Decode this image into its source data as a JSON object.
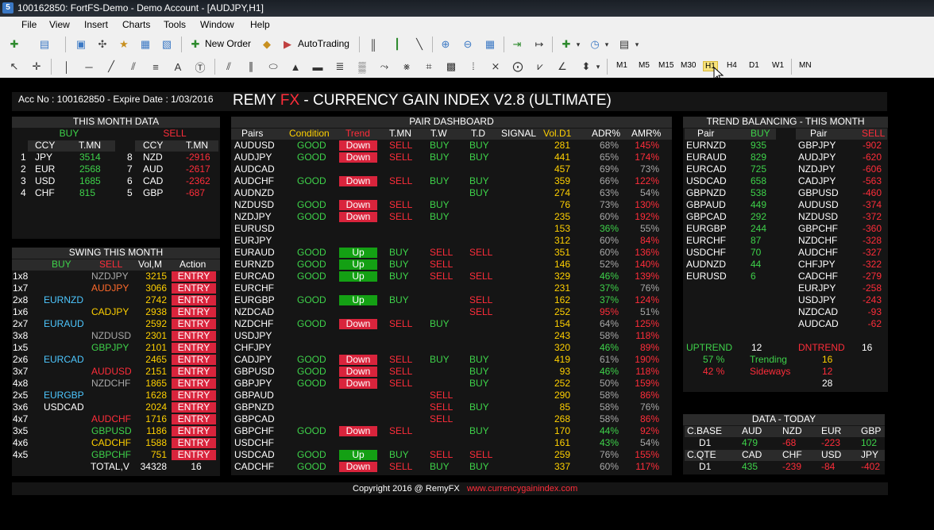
{
  "window": {
    "title": "100162850: FortFS-Demo - Demo Account - [AUDJPY,H1]"
  },
  "menu": [
    "File",
    "View",
    "Insert",
    "Charts",
    "Tools",
    "Window",
    "Help"
  ],
  "toolbar": {
    "new_order": "New Order",
    "autotrading": "AutoTrading"
  },
  "timeframes": [
    "M1",
    "M5",
    "M15",
    "M30",
    "H1",
    "H4",
    "D1",
    "W1",
    "MN"
  ],
  "header": {
    "acc": "Acc No : 100162850 - Expire Date : 1/03/2016",
    "brand1": "REMY ",
    "brand2": "FX",
    "brand3": " - CURRENCY GAIN INDEX V2.8 (ULTIMATE)"
  },
  "month": {
    "title": "THIS MONTH DATA",
    "buy": "BUY",
    "sell": "SELL",
    "col_ccy": "CCY",
    "col_tmn": "T.MN",
    "buy_rows": [
      {
        "n": "1",
        "ccy": "JPY",
        "v": "3514"
      },
      {
        "n": "2",
        "ccy": "EUR",
        "v": "2568"
      },
      {
        "n": "3",
        "ccy": "USD",
        "v": "1685"
      },
      {
        "n": "4",
        "ccy": "CHF",
        "v": "815"
      }
    ],
    "sell_rows": [
      {
        "n": "8",
        "ccy": "NZD",
        "v": "-2916"
      },
      {
        "n": "7",
        "ccy": "AUD",
        "v": "-2617"
      },
      {
        "n": "6",
        "ccy": "CAD",
        "v": "-2362"
      },
      {
        "n": "5",
        "ccy": "GBP",
        "v": "-687"
      }
    ]
  },
  "swing": {
    "title": "SWING THIS MONTH",
    "h_buy": "BUY",
    "h_sell": "SELL",
    "h_vol": "Vol,M",
    "h_action": "Action",
    "rows": [
      {
        "r": "1x8",
        "b": "",
        "s": "NZDJPY",
        "sc": "gry",
        "v": "3215",
        "a": "ENTRY"
      },
      {
        "r": "1x7",
        "b": "",
        "s": "AUDJPY",
        "sc": "org",
        "v": "3066",
        "a": "ENTRY"
      },
      {
        "r": "2x8",
        "b": "EURNZD",
        "bc": "cyn",
        "s": "",
        "v": "2742",
        "a": "ENTRY"
      },
      {
        "r": "1x6",
        "b": "",
        "s": "CADJPY",
        "sc": "yel",
        "v": "2938",
        "a": "ENTRY"
      },
      {
        "r": "2x7",
        "b": "EURAUD",
        "bc": "cyn",
        "s": "",
        "v": "2592",
        "a": "ENTRY"
      },
      {
        "r": "3x8",
        "b": "",
        "s": "NZDUSD",
        "sc": "gry",
        "v": "2301",
        "a": "ENTRY"
      },
      {
        "r": "1x5",
        "b": "",
        "s": "GBPJPY",
        "sc": "grn",
        "v": "2101",
        "a": "ENTRY"
      },
      {
        "r": "2x6",
        "b": "EURCAD",
        "bc": "cyn",
        "s": "",
        "v": "2465",
        "a": "ENTRY"
      },
      {
        "r": "3x7",
        "b": "",
        "s": "AUDUSD",
        "sc": "red",
        "v": "2151",
        "a": "ENTRY"
      },
      {
        "r": "4x8",
        "b": "",
        "s": "NZDCHF",
        "sc": "gry",
        "v": "1865",
        "a": "ENTRY"
      },
      {
        "r": "2x5",
        "b": "EURGBP",
        "bc": "cyn",
        "s": "",
        "v": "1628",
        "a": "ENTRY"
      },
      {
        "r": "3x6",
        "b": "USDCAD",
        "bc": "wht",
        "s": "",
        "v": "2024",
        "a": "ENTRY"
      },
      {
        "r": "4x7",
        "b": "",
        "s": "AUDCHF",
        "sc": "red",
        "v": "1716",
        "a": "ENTRY"
      },
      {
        "r": "3x5",
        "b": "",
        "s": "GBPUSD",
        "sc": "grn",
        "v": "1186",
        "a": "ENTRY"
      },
      {
        "r": "4x6",
        "b": "",
        "s": "CADCHF",
        "sc": "yel",
        "v": "1588",
        "a": "ENTRY"
      },
      {
        "r": "4x5",
        "b": "",
        "s": "GBPCHF",
        "sc": "grn",
        "v": "751",
        "a": "ENTRY"
      }
    ],
    "total_label": "TOTAL,V",
    "total_vol": "34328",
    "total_count": "16"
  },
  "dashboard": {
    "title": "PAIR DASHBOARD",
    "cols": {
      "pairs": "Pairs",
      "cond": "Condition",
      "trend": "Trend",
      "tmn": "T.MN",
      "tw": "T.W",
      "td": "T.D",
      "signal": "SIGNAL",
      "vol": "Vol.D1",
      "adr": "ADR%",
      "amr": "AMR%"
    },
    "rows": [
      {
        "p": "AUDUSD",
        "c": "GOOD",
        "t": "Down",
        "m": "SELL",
        "w": "BUY",
        "d": "BUY",
        "v": "281",
        "adr": "68%",
        "ac": "gry",
        "amr": "145%",
        "mc": "red"
      },
      {
        "p": "AUDJPY",
        "c": "GOOD",
        "t": "Down",
        "m": "SELL",
        "w": "BUY",
        "d": "BUY",
        "v": "441",
        "adr": "65%",
        "ac": "gry",
        "amr": "174%",
        "mc": "red"
      },
      {
        "p": "AUDCAD",
        "c": "",
        "t": "",
        "m": "",
        "w": "",
        "d": "",
        "v": "457",
        "adr": "69%",
        "ac": "gry",
        "amr": "73%",
        "mc": "gry"
      },
      {
        "p": "AUDCHF",
        "c": "GOOD",
        "t": "Down",
        "m": "SELL",
        "w": "BUY",
        "d": "BUY",
        "v": "359",
        "adr": "66%",
        "ac": "gry",
        "amr": "122%",
        "mc": "red"
      },
      {
        "p": "AUDNZD",
        "c": "",
        "t": "",
        "m": "",
        "w": "",
        "d": "BUY",
        "v": "274",
        "adr": "63%",
        "ac": "gry",
        "amr": "54%",
        "mc": "gry"
      },
      {
        "p": "NZDUSD",
        "c": "GOOD",
        "t": "Down",
        "m": "SELL",
        "w": "BUY",
        "d": "",
        "v": "76",
        "adr": "73%",
        "ac": "gry",
        "amr": "130%",
        "mc": "red"
      },
      {
        "p": "NZDJPY",
        "c": "GOOD",
        "t": "Down",
        "m": "SELL",
        "w": "BUY",
        "d": "",
        "v": "235",
        "adr": "60%",
        "ac": "gry",
        "amr": "192%",
        "mc": "red"
      },
      {
        "p": "EURUSD",
        "c": "",
        "t": "",
        "m": "",
        "w": "",
        "d": "",
        "v": "153",
        "adr": "36%",
        "ac": "grn",
        "amr": "55%",
        "mc": "gry"
      },
      {
        "p": "EURJPY",
        "c": "",
        "t": "",
        "m": "",
        "w": "",
        "d": "",
        "v": "312",
        "adr": "60%",
        "ac": "gry",
        "amr": "84%",
        "mc": "red"
      },
      {
        "p": "EURAUD",
        "c": "GOOD",
        "t": "Up",
        "m": "BUY",
        "w": "SELL",
        "d": "SELL",
        "v": "351",
        "adr": "60%",
        "ac": "gry",
        "amr": "136%",
        "mc": "red"
      },
      {
        "p": "EURNZD",
        "c": "GOOD",
        "t": "Up",
        "m": "BUY",
        "w": "SELL",
        "d": "",
        "v": "146",
        "adr": "52%",
        "ac": "gry",
        "amr": "140%",
        "mc": "red"
      },
      {
        "p": "EURCAD",
        "c": "GOOD",
        "t": "Up",
        "m": "BUY",
        "w": "SELL",
        "d": "SELL",
        "v": "329",
        "adr": "46%",
        "ac": "grn",
        "amr": "139%",
        "mc": "red"
      },
      {
        "p": "EURCHF",
        "c": "",
        "t": "",
        "m": "",
        "w": "",
        "d": "",
        "v": "231",
        "adr": "37%",
        "ac": "grn",
        "amr": "76%",
        "mc": "gry"
      },
      {
        "p": "EURGBP",
        "c": "GOOD",
        "t": "Up",
        "m": "BUY",
        "w": "",
        "d": "SELL",
        "v": "162",
        "adr": "37%",
        "ac": "grn",
        "amr": "124%",
        "mc": "red"
      },
      {
        "p": "NZDCAD",
        "c": "",
        "t": "",
        "m": "",
        "w": "",
        "d": "SELL",
        "v": "252",
        "adr": "95%",
        "ac": "red",
        "amr": "51%",
        "mc": "gry"
      },
      {
        "p": "NZDCHF",
        "c": "GOOD",
        "t": "Down",
        "m": "SELL",
        "w": "BUY",
        "d": "",
        "v": "154",
        "adr": "64%",
        "ac": "gry",
        "amr": "125%",
        "mc": "red"
      },
      {
        "p": "USDJPY",
        "c": "",
        "t": "",
        "m": "",
        "w": "",
        "d": "",
        "v": "243",
        "adr": "58%",
        "ac": "gry",
        "amr": "118%",
        "mc": "red"
      },
      {
        "p": "CHFJPY",
        "c": "",
        "t": "",
        "m": "",
        "w": "",
        "d": "",
        "v": "320",
        "adr": "46%",
        "ac": "grn",
        "amr": "89%",
        "mc": "red"
      },
      {
        "p": "CADJPY",
        "c": "GOOD",
        "t": "Down",
        "m": "SELL",
        "w": "BUY",
        "d": "BUY",
        "v": "419",
        "adr": "61%",
        "ac": "gry",
        "amr": "190%",
        "mc": "red"
      },
      {
        "p": "GBPUSD",
        "c": "GOOD",
        "t": "Down",
        "m": "SELL",
        "w": "",
        "d": "BUY",
        "v": "93",
        "adr": "46%",
        "ac": "grn",
        "amr": "118%",
        "mc": "red"
      },
      {
        "p": "GBPJPY",
        "c": "GOOD",
        "t": "Down",
        "m": "SELL",
        "w": "",
        "d": "BUY",
        "v": "252",
        "adr": "50%",
        "ac": "gry",
        "amr": "159%",
        "mc": "red"
      },
      {
        "p": "GBPAUD",
        "c": "",
        "t": "",
        "m": "",
        "w": "SELL",
        "d": "",
        "v": "290",
        "adr": "58%",
        "ac": "gry",
        "amr": "86%",
        "mc": "red"
      },
      {
        "p": "GBPNZD",
        "c": "",
        "t": "",
        "m": "",
        "w": "SELL",
        "d": "BUY",
        "v": "85",
        "adr": "58%",
        "ac": "gry",
        "amr": "76%",
        "mc": "gry"
      },
      {
        "p": "GBPCAD",
        "c": "",
        "t": "",
        "m": "",
        "w": "SELL",
        "d": "",
        "v": "268",
        "adr": "58%",
        "ac": "gry",
        "amr": "86%",
        "mc": "red"
      },
      {
        "p": "GBPCHF",
        "c": "GOOD",
        "t": "Down",
        "m": "SELL",
        "w": "",
        "d": "BUY",
        "v": "170",
        "adr": "44%",
        "ac": "grn",
        "amr": "92%",
        "mc": "red"
      },
      {
        "p": "USDCHF",
        "c": "",
        "t": "",
        "m": "",
        "w": "",
        "d": "",
        "v": "161",
        "adr": "43%",
        "ac": "grn",
        "amr": "54%",
        "mc": "gry"
      },
      {
        "p": "USDCAD",
        "c": "GOOD",
        "t": "Up",
        "m": "BUY",
        "w": "SELL",
        "d": "SELL",
        "v": "259",
        "adr": "76%",
        "ac": "gry",
        "amr": "155%",
        "mc": "red"
      },
      {
        "p": "CADCHF",
        "c": "GOOD",
        "t": "Down",
        "m": "SELL",
        "w": "BUY",
        "d": "BUY",
        "v": "337",
        "adr": "60%",
        "ac": "gry",
        "amr": "117%",
        "mc": "red"
      }
    ]
  },
  "trend": {
    "title": "TREND BALANCING - THIS MONTH",
    "h_pair": "Pair",
    "h_buy": "BUY",
    "h_sell": "SELL",
    "buy_rows": [
      {
        "p": "EURNZD",
        "v": "935"
      },
      {
        "p": "EURAUD",
        "v": "829"
      },
      {
        "p": "EURCAD",
        "v": "725"
      },
      {
        "p": "USDCAD",
        "v": "658"
      },
      {
        "p": "GBPNZD",
        "v": "538"
      },
      {
        "p": "GBPAUD",
        "v": "449"
      },
      {
        "p": "GBPCAD",
        "v": "292"
      },
      {
        "p": "EURGBP",
        "v": "244"
      },
      {
        "p": "EURCHF",
        "v": "87"
      },
      {
        "p": "USDCHF",
        "v": "70"
      },
      {
        "p": "AUDNZD",
        "v": "44"
      },
      {
        "p": "EURUSD",
        "v": "6"
      }
    ],
    "sell_rows": [
      {
        "p": "GBPJPY",
        "v": "-902"
      },
      {
        "p": "AUDJPY",
        "v": "-620"
      },
      {
        "p": "NZDJPY",
        "v": "-606"
      },
      {
        "p": "CADJPY",
        "v": "-563"
      },
      {
        "p": "GBPUSD",
        "v": "-460"
      },
      {
        "p": "AUDUSD",
        "v": "-374"
      },
      {
        "p": "NZDUSD",
        "v": "-372"
      },
      {
        "p": "GBPCHF",
        "v": "-360"
      },
      {
        "p": "NZDCHF",
        "v": "-328"
      },
      {
        "p": "AUDCHF",
        "v": "-327"
      },
      {
        "p": "CHFJPY",
        "v": "-322"
      },
      {
        "p": "CADCHF",
        "v": "-279"
      },
      {
        "p": "EURJPY",
        "v": "-258"
      },
      {
        "p": "USDJPY",
        "v": "-243"
      },
      {
        "p": "NZDCAD",
        "v": "-93"
      },
      {
        "p": "AUDCAD",
        "v": "-62"
      }
    ],
    "uptrend_label": "UPTREND",
    "uptrend_val": "12",
    "dntrend_label": "DNTREND",
    "dntrend_val": "16",
    "pct_up": "57 %",
    "trending_label": "Trending",
    "trending_val": "16",
    "pct_dn": "42 %",
    "sideways_label": "Sideways",
    "sideways_val": "12",
    "total": "28"
  },
  "today": {
    "title": "DATA - TODAY",
    "base_label": "C.BASE",
    "base_ccys": [
      "AUD",
      "NZD",
      "EUR",
      "GBP"
    ],
    "base_tf": "D1",
    "base_vals": [
      "479",
      "-68",
      "-223",
      "102"
    ],
    "qte_label": "C.QTE",
    "qte_ccys": [
      "CAD",
      "CHF",
      "USD",
      "JPY"
    ],
    "qte_tf": "D1",
    "qte_vals": [
      "435",
      "-239",
      "-84",
      "-402"
    ]
  },
  "footer": {
    "copy": "Copyright 2016 @ RemyFX",
    "url": "www.currencygainindex.com"
  },
  "colors": {
    "good": "#3ed24a",
    "bad": "#ff2d3a",
    "badge_down": "#d9243c",
    "badge_up": "#14a014",
    "vol": "#ffd000"
  }
}
